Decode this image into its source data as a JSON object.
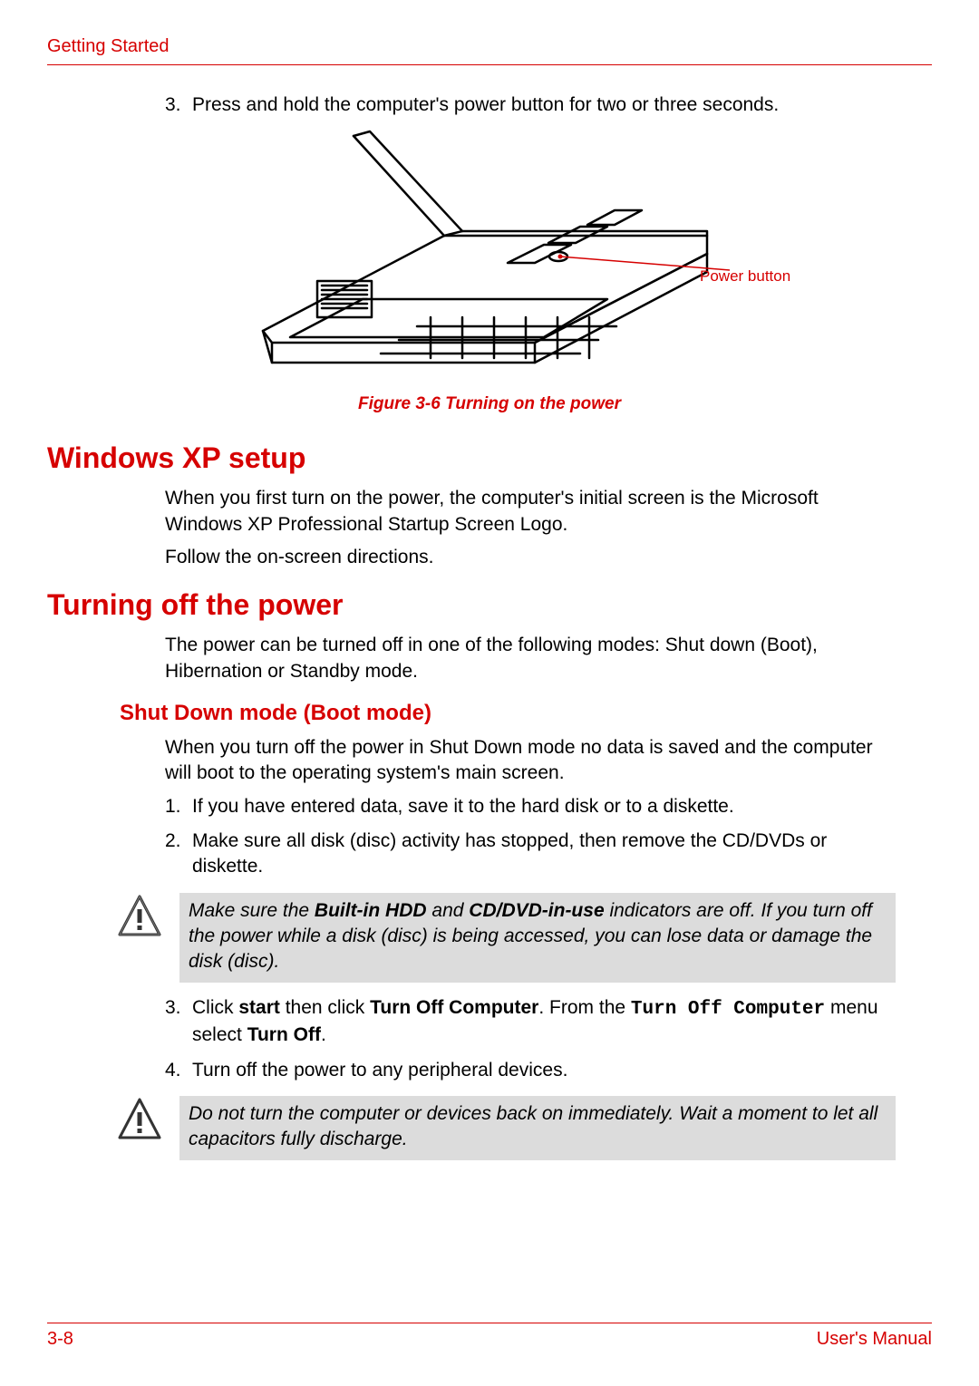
{
  "header": {
    "section": "Getting Started"
  },
  "steps_top": {
    "item3": {
      "num": "3.",
      "text": "Press and hold the computer's power button for two or three seconds."
    }
  },
  "figure": {
    "callout": "Power button",
    "caption": "Figure 3-6 Turning on the power"
  },
  "sections": {
    "xp_setup": {
      "title": "Windows XP setup",
      "p1": "When you first turn on the power, the computer's initial screen is the Microsoft Windows XP Professional Startup Screen Logo.",
      "p2": "Follow the on-screen directions."
    },
    "turning_off": {
      "title": "Turning off the power",
      "p1": "The power can be turned off in one of the following modes: Shut down (Boot), Hibernation or Standby mode."
    },
    "shutdown": {
      "title": "Shut Down mode (Boot mode)",
      "p1": "When you turn off the power in Shut Down mode no data is saved and the computer will boot to the operating system's main screen.",
      "step1": {
        "num": "1.",
        "text": "If you have entered data, save it to the hard disk or to a diskette."
      },
      "step2": {
        "num": "2.",
        "text": "Make sure all disk (disc) activity has stopped, then remove the CD/DVDs or diskette."
      },
      "caution1": {
        "pre": "Make sure the ",
        "b1": "Built-in HDD",
        "mid1": " and ",
        "b2": "CD/DVD-in-use",
        "post": " indicators are off. If you turn off the power while a disk (disc) is being accessed, you can lose data or damage the disk (disc)."
      },
      "step3": {
        "num": "3.",
        "pre": "Click ",
        "b1": "start",
        "mid1": " then click ",
        "b2": "Turn Off Computer",
        "mid2": ". From the ",
        "mono": "Turn Off Computer",
        "mid3": " menu select ",
        "b3": "Turn Off",
        "end": "."
      },
      "step4": {
        "num": "4.",
        "text": "Turn off the power to any peripheral devices."
      },
      "caution2": "Do not turn the computer or devices back on immediately. Wait a moment to let all capacitors fully discharge."
    }
  },
  "footer": {
    "page": "3-8",
    "doc": "User's Manual"
  }
}
